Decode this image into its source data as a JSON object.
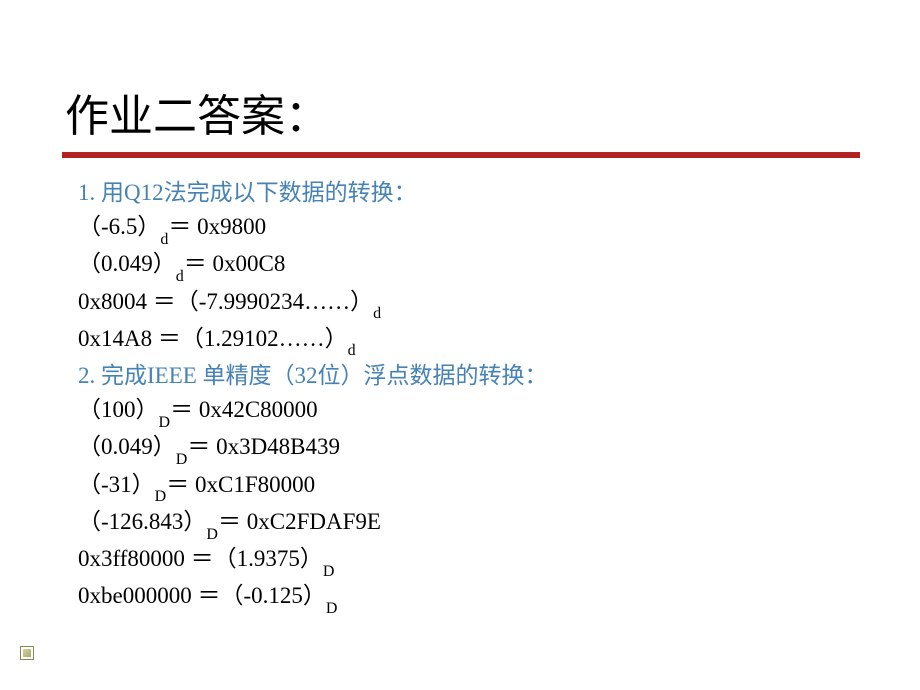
{
  "title": "作业二答案：",
  "question1": {
    "heading": "1. 用Q12法完成以下数据的转换：",
    "lines": [
      {
        "prefix": "（-6.5）",
        "sub": "d",
        "rest": "＝ 0x9800"
      },
      {
        "prefix": "（0.049）",
        "sub": "d",
        "rest": "＝ 0x00C8"
      },
      {
        "prefix": "0x8004 ＝（-7.9990234……）",
        "sub": "d",
        "rest": ""
      },
      {
        "prefix": "0x14A8 ＝（1.29102……）",
        "sub": "d",
        "rest": ""
      }
    ]
  },
  "question2": {
    "heading": "2. 完成IEEE 单精度（32位）浮点数据的转换：",
    "lines": [
      {
        "prefix": "（100）",
        "sub": "D",
        "rest": "＝ 0x42C80000"
      },
      {
        "prefix": "（0.049）",
        "sub": "D",
        "rest": "＝ 0x3D48B439"
      },
      {
        "prefix": "（-31）",
        "sub": "D",
        "rest": "＝ 0xC1F80000"
      },
      {
        "prefix": "（-126.843）",
        "sub": "D",
        "rest": "＝ 0xC2FDAF9E"
      },
      {
        "prefix": "0x3ff80000 ＝（1.9375）",
        "sub": "D",
        "rest": ""
      },
      {
        "prefix": "0xbe000000 ＝（-0.125）",
        "sub": "D",
        "rest": ""
      }
    ]
  }
}
